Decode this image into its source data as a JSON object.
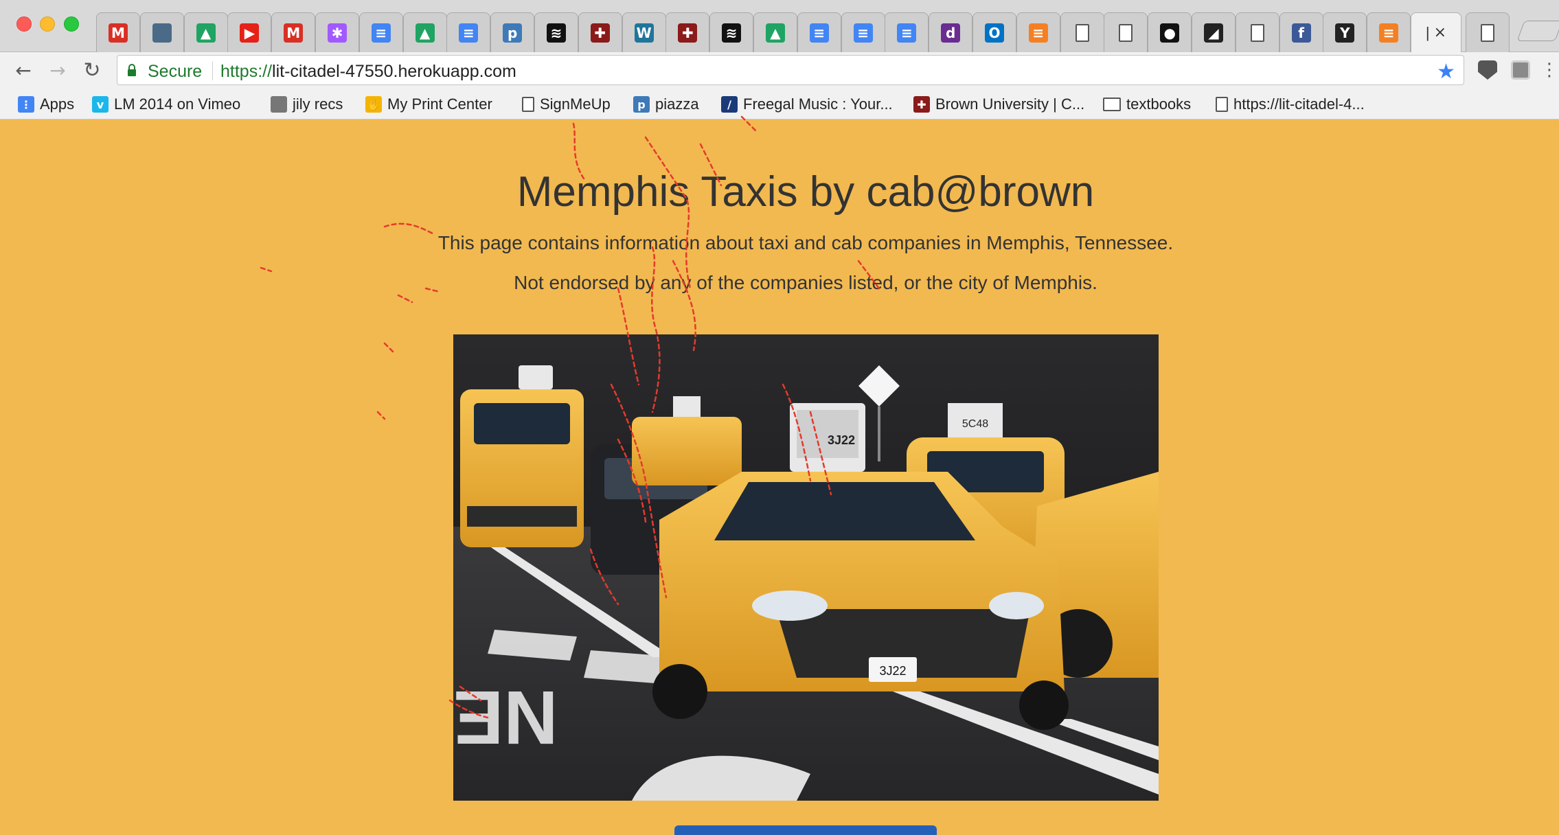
{
  "browser": {
    "tabs": [
      {
        "icon": "gmail-icon",
        "glyph": "M",
        "color": "#d93025"
      },
      {
        "icon": "image-tab-icon",
        "glyph": "",
        "color": "#4b6a88"
      },
      {
        "icon": "google-drive-icon",
        "glyph": "▲",
        "color": "#1fa463"
      },
      {
        "icon": "youtube-icon",
        "glyph": "▶",
        "color": "#e62117"
      },
      {
        "icon": "gmail-icon",
        "glyph": "M",
        "color": "#d93025"
      },
      {
        "icon": "figma-icon",
        "glyph": "✱",
        "color": "#a259ff"
      },
      {
        "icon": "google-docs-icon",
        "glyph": "≡",
        "color": "#4285f4"
      },
      {
        "icon": "google-drive-icon",
        "glyph": "▲",
        "color": "#1fa463"
      },
      {
        "icon": "google-docs-icon",
        "glyph": "≡",
        "color": "#4285f4"
      },
      {
        "icon": "piazza-icon",
        "glyph": "p",
        "color": "#3e7ab8"
      },
      {
        "icon": "stripes-icon",
        "glyph": "≋",
        "color": "#111111"
      },
      {
        "icon": "brown-shield-icon",
        "glyph": "✚",
        "color": "#8b1a1a"
      },
      {
        "icon": "wordpress-icon",
        "glyph": "W",
        "color": "#21759b"
      },
      {
        "icon": "brown-shield-icon",
        "glyph": "✚",
        "color": "#8b1a1a"
      },
      {
        "icon": "stripes-icon",
        "glyph": "≋",
        "color": "#111111"
      },
      {
        "icon": "google-drive-icon",
        "glyph": "▲",
        "color": "#1fa463"
      },
      {
        "icon": "google-docs-icon",
        "glyph": "≡",
        "color": "#4285f4"
      },
      {
        "icon": "google-docs-icon",
        "glyph": "≡",
        "color": "#4285f4"
      },
      {
        "icon": "google-docs-icon",
        "glyph": "≡",
        "color": "#4285f4"
      },
      {
        "icon": "dq-icon",
        "glyph": "d",
        "color": "#6a2c91"
      },
      {
        "icon": "outlook-icon",
        "glyph": "O",
        "color": "#0072c6"
      },
      {
        "icon": "stack-overflow-icon",
        "glyph": "≡",
        "color": "#f48024"
      },
      {
        "icon": "document-icon",
        "glyph": "",
        "color": "#ffffff"
      },
      {
        "icon": "document-icon",
        "glyph": "",
        "color": "#ffffff"
      },
      {
        "icon": "github-icon",
        "glyph": "●",
        "color": "#111111"
      },
      {
        "icon": "edit-icon",
        "glyph": "◢",
        "color": "#222222"
      },
      {
        "icon": "document-icon",
        "glyph": "",
        "color": "#ffffff"
      },
      {
        "icon": "facebook-icon",
        "glyph": "f",
        "color": "#3b5998"
      },
      {
        "icon": "y-icon",
        "glyph": "Y",
        "color": "#222222"
      },
      {
        "icon": "stack-overflow-icon",
        "glyph": "≡",
        "color": "#f48024"
      }
    ],
    "active_tab_label": "|",
    "active_tab_close": "×",
    "after_tab_icon": "document-icon",
    "secure_label": "Secure",
    "url_scheme": "https://",
    "url_rest": "lit-citadel-47550.herokuapp.com",
    "bookmarks": [
      {
        "label": "Apps",
        "icon": "apps-grid-icon",
        "color": "#4285f4",
        "glyph": "⋮"
      },
      {
        "label": "LM 2014 on Vimeo",
        "icon": "vimeo-icon",
        "color": "#1ab7ea",
        "glyph": "v"
      },
      {
        "label": "jily recs",
        "icon": "photo-icon",
        "color": "#777777",
        "glyph": ""
      },
      {
        "label": "My Print Center",
        "icon": "hand-icon",
        "color": "#f4b400",
        "glyph": "✋"
      },
      {
        "label": "SignMeUp",
        "icon": "document-icon",
        "color": "",
        "glyph": ""
      },
      {
        "label": "piazza",
        "icon": "piazza-icon",
        "color": "#3e7ab8",
        "glyph": "p"
      },
      {
        "label": "Freegal Music : Your...",
        "icon": "freegal-icon",
        "color": "#1a3a7a",
        "glyph": "∕"
      },
      {
        "label": "Brown University | C...",
        "icon": "brown-shield-icon",
        "color": "#8b1a1a",
        "glyph": "✚"
      },
      {
        "label": "textbooks",
        "icon": "folder-icon",
        "color": "",
        "glyph": ""
      },
      {
        "label": "https://lit-citadel-4...",
        "icon": "document-icon",
        "color": "",
        "glyph": ""
      }
    ]
  },
  "page": {
    "title": "Memphis Taxis by cab@brown",
    "intro": "This page contains information about taxi and cab companies in Memphis, Tennessee.",
    "disclaimer": "Not endorsed by any of the companies listed, or the city of Memphis.",
    "hero_image": "taxi-street-photo",
    "background": "#f2b950",
    "button_color": "#2560b8",
    "plates": [
      "3J22",
      "3J22",
      "5C48"
    ]
  }
}
